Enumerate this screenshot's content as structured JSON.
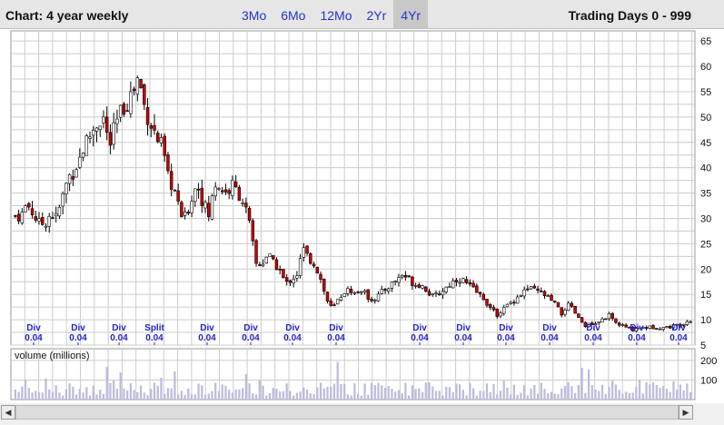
{
  "header": {
    "chart_title": "Chart: 4 year weekly",
    "tabs": [
      {
        "label": "3Mo",
        "active": false
      },
      {
        "label": "6Mo",
        "active": false
      },
      {
        "label": "12Mo",
        "active": false
      },
      {
        "label": "2Yr",
        "active": false
      },
      {
        "label": "4Yr",
        "active": true
      }
    ],
    "trading_days": "Trading Days 0 - 999"
  },
  "colors": {
    "up": "#ffffff",
    "down": "#cc0000",
    "wick": "#000000",
    "grid": "#cccccc",
    "volume": "#bbbbdd",
    "annotation": "#2222cc"
  },
  "chart_data": {
    "type": "candlestick",
    "price_axis": {
      "ticks": [
        5,
        10,
        15,
        20,
        25,
        30,
        35,
        40,
        45,
        50,
        55,
        60,
        65
      ],
      "ylim": [
        5,
        67
      ]
    },
    "volume_axis": {
      "label": "volume (millions)",
      "ticks": [
        100,
        200
      ],
      "ylim": [
        0,
        260
      ]
    },
    "grid": true,
    "price_anchors": [
      30.5,
      30.5,
      33,
      31,
      29,
      29,
      31,
      30,
      34,
      38,
      39.5,
      42,
      45,
      47,
      49,
      50,
      44,
      48,
      51,
      53,
      55,
      58,
      52,
      49,
      46,
      44,
      38,
      36,
      31,
      30,
      34,
      37,
      33,
      30.5,
      37,
      36,
      35,
      36.5,
      35,
      33,
      28,
      21,
      21,
      23,
      21,
      20,
      17,
      18,
      19,
      24,
      22,
      21,
      18,
      14,
      12,
      14,
      15.5,
      16,
      15,
      16,
      14.5,
      14,
      15,
      16,
      17,
      18,
      19,
      18,
      17,
      17,
      16,
      14.5,
      15,
      16,
      17,
      18,
      18,
      17,
      16,
      15,
      14,
      12,
      11,
      12,
      13,
      14,
      15,
      16,
      16,
      15.5,
      15,
      14,
      13,
      11,
      13,
      12,
      10,
      9,
      9,
      9,
      10,
      11,
      9.5,
      9,
      8.5,
      8,
      8.5,
      8.5,
      8.5,
      8.5,
      8.5,
      8.5,
      8.8,
      9,
      9.5,
      10
    ],
    "dividends": [
      {
        "label": "Div",
        "value": "0.04"
      },
      {
        "label": "Div",
        "value": "0.04"
      },
      {
        "label": "Div",
        "value": "0.04"
      },
      {
        "label": "Split",
        "value": "0.04"
      },
      {
        "label": "Div",
        "value": "0.04"
      },
      {
        "label": "Div",
        "value": "0.04"
      },
      {
        "label": "Div",
        "value": "0.04"
      },
      {
        "label": "Div",
        "value": "0.04"
      },
      {
        "label": "Div",
        "value": "0.04"
      },
      {
        "label": "Div",
        "value": "0.04"
      },
      {
        "label": "Div",
        "value": "0.04"
      },
      {
        "label": "Div",
        "value": "0.04"
      },
      {
        "label": "Div",
        "value": "0.04"
      },
      {
        "label": "Div",
        "value": "0.04"
      },
      {
        "label": "Div",
        "value": "0.04"
      }
    ]
  }
}
